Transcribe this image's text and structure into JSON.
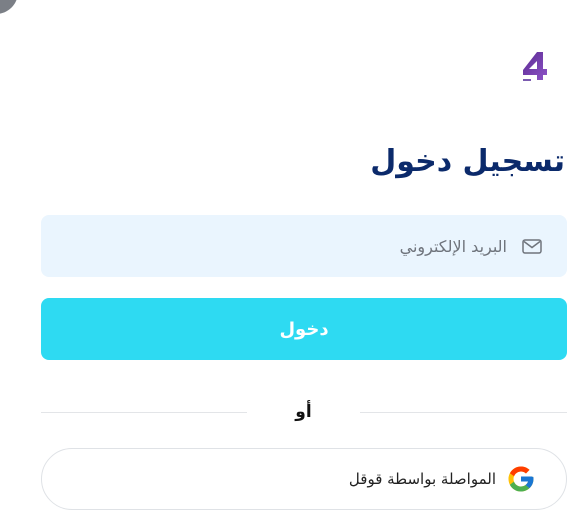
{
  "page": {
    "title": "تسجيل دخول",
    "logo": "logo-4-icon"
  },
  "email": {
    "placeholder": "البريد الإلكتروني",
    "value": "",
    "icon": "mail-icon"
  },
  "login_button": {
    "label": "دخول",
    "color": "#2edaf2"
  },
  "divider": {
    "label": "أو"
  },
  "google_button": {
    "label": "المواصلة بواسطة قوقل",
    "icon": "google-icon"
  },
  "colors": {
    "title": "#0b2a6b",
    "input_bg": "#eaf5fe",
    "accent": "#2edaf2"
  }
}
